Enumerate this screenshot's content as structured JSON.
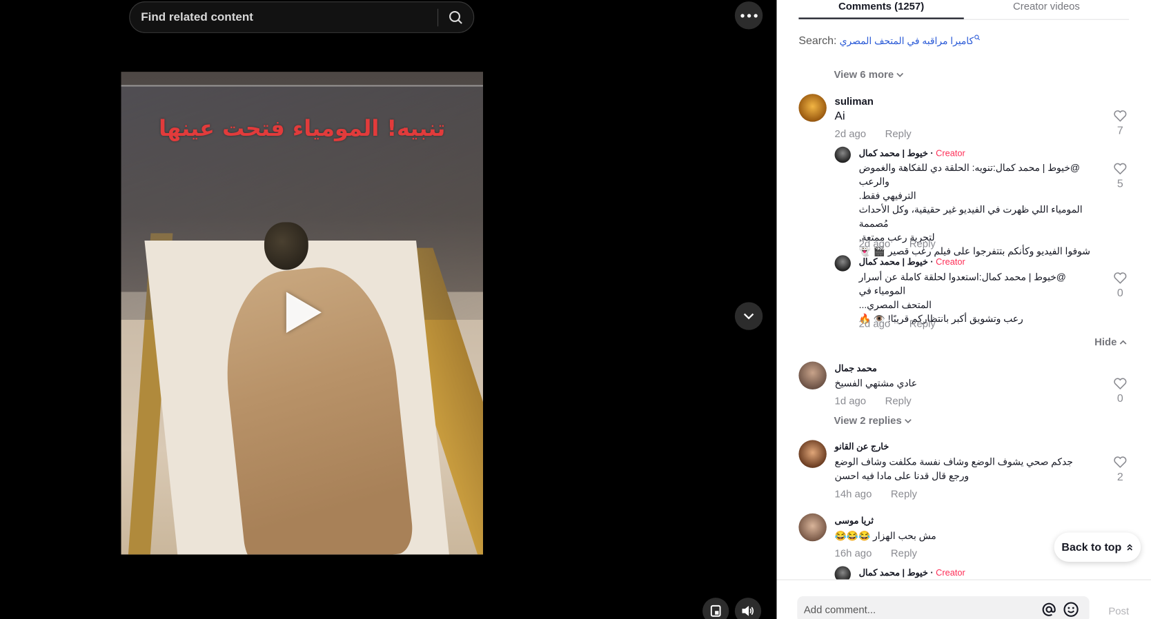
{
  "search": {
    "placeholder": "Find related content"
  },
  "video": {
    "overlay_text": "تنبيه! المومياء فتحت عينها"
  },
  "tabs": [
    {
      "label": "Comments (1257)",
      "active": true
    },
    {
      "label": "Creator videos",
      "active": false
    }
  ],
  "search_suggestion": {
    "label": "Search:",
    "query": "كاميرا مراقبه في المتحف المصري"
  },
  "view_more_top": "View 6 more",
  "comments": [
    {
      "user": "suliman",
      "text": "Ai",
      "time": "2d ago",
      "reply": "Reply",
      "likes": "7"
    },
    {
      "user": "محمد جمال",
      "text": "عادي مشتهي الفسيخ",
      "time": "1d ago",
      "reply": "Reply",
      "likes": "0",
      "view_replies": "View 2 replies"
    },
    {
      "user": "خارج عن القانو",
      "text": "جدكم صحي يشوف الوضع وشاف نفسة مكلفت وشاف الوضع ورجع قال قدنا على مادا فيه احسن",
      "time": "14h ago",
      "reply": "Reply",
      "likes": "2"
    },
    {
      "user": "ثريا موسى",
      "text": "مش بحب الهزار 😂😂😂",
      "time": "16h ago",
      "reply": "Reply"
    }
  ],
  "replies": [
    {
      "user": "خيوط | محمد كمال",
      "badge": "Creator",
      "sep": "·",
      "line1": "@خيوط | محمد كمال:تنويه: الحلقة دي للفكاهة والغموض والرعب",
      "line2": "الترفيهي فقط.",
      "line3": "المومياء اللي ظهرت في الفيديو غير حقيقية، وكل الأحداث مُصممة",
      "line4": "لتجربة رعب ممتعة.",
      "line5": "شوفوا الفيديو وكأنكم بتتفرجوا على فيلم رعب قصير 🎬 👻",
      "time": "2d ago",
      "reply": "Reply",
      "likes": "5"
    },
    {
      "user": "خيوط | محمد كمال",
      "badge": "Creator",
      "sep": "·",
      "line1": "@خيوط | محمد كمال:استعدوا لحلقة كاملة عن أسرار المومياء في",
      "line2": "المتحف المصري...",
      "line3": "رعب وتشويق أكبر بانتظاركم قريبًا! 👁️ 🔥",
      "time": "2d ago",
      "reply": "Reply",
      "likes": "0"
    },
    {
      "user": "خيوط | محمد كمال",
      "badge": "Creator",
      "sep": "·"
    }
  ],
  "hide_label": "Hide",
  "back_to_top": "Back to top",
  "comment_box": {
    "placeholder": "Add comment...",
    "post": "Post"
  },
  "colors": {
    "accent": "#fe2c55",
    "link": "#2b5bd7"
  }
}
